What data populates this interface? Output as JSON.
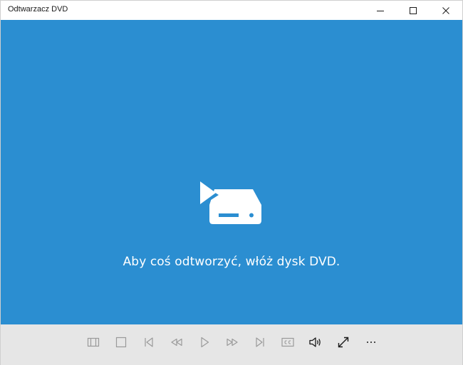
{
  "window": {
    "title": "Odtwarzacz DVD",
    "controls": [
      "minimize-icon",
      "maximize-icon",
      "close-icon"
    ]
  },
  "main": {
    "message": "Aby coś odtworzyć, włóż dysk DVD.",
    "background_color": "#2b8ed1",
    "illustration": "dvd-drive-icon"
  },
  "controlbar": {
    "background_color": "#e6e6e6",
    "disabled_color": "#9a9a9a",
    "enabled_color": "#1a1a1a",
    "buttons": [
      {
        "icon": "menu-panel-icon",
        "enabled": false
      },
      {
        "icon": "stop-icon",
        "enabled": false
      },
      {
        "icon": "skip-back-icon",
        "enabled": false
      },
      {
        "icon": "rewind-icon",
        "enabled": false
      },
      {
        "icon": "play-icon",
        "enabled": false
      },
      {
        "icon": "fast-forward-icon",
        "enabled": false
      },
      {
        "icon": "skip-forward-icon",
        "enabled": false
      },
      {
        "icon": "closed-captions-icon",
        "enabled": false
      },
      {
        "icon": "volume-icon",
        "enabled": true
      },
      {
        "icon": "fullscreen-icon",
        "enabled": true
      },
      {
        "icon": "more-icon",
        "enabled": true
      }
    ]
  }
}
